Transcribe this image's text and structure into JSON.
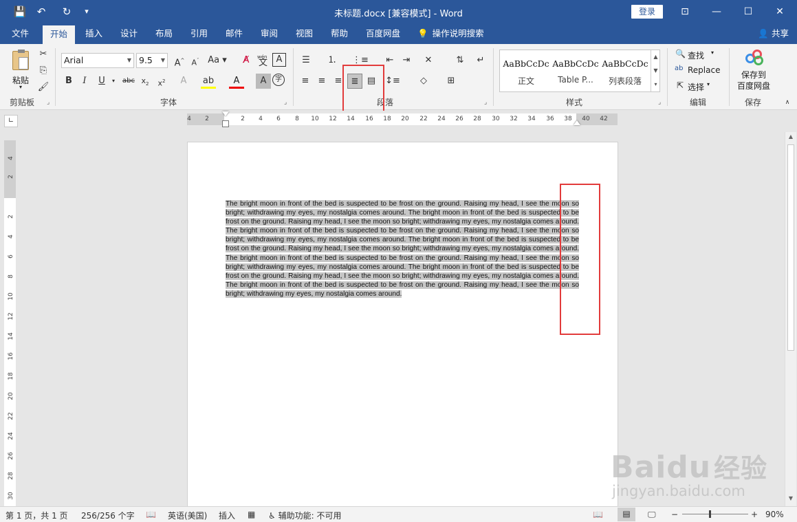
{
  "titlebar": {
    "title": "未标题.docx [兼容模式]  -  Word",
    "login": "登录",
    "quick_access": {
      "save": "💾",
      "undo": "↶",
      "redo": "↻",
      "customize": "▾"
    },
    "window_buttons": {
      "ribbon_options": "⊡",
      "minimize": "—",
      "maximize": "☐",
      "close": "✕"
    }
  },
  "tabs": [
    "文件",
    "开始",
    "插入",
    "设计",
    "布局",
    "引用",
    "邮件",
    "审阅",
    "视图",
    "帮助",
    "百度网盘",
    "操作说明搜索"
  ],
  "active_tab": "开始",
  "share": "共享",
  "ribbon": {
    "clipboard": {
      "paste_label": "粘贴",
      "group_label": "剪贴板"
    },
    "font": {
      "name": "Arial",
      "size": "9.5",
      "group_label": "字体",
      "pinyin": "wén"
    },
    "paragraph": {
      "group_label": "段落"
    },
    "styles": {
      "group_label": "样式",
      "items": [
        {
          "sample": "AaBbCcDc",
          "name": "正文"
        },
        {
          "sample": "AaBbCcDc",
          "name": "Table P..."
        },
        {
          "sample": "AaBbCcDc",
          "name": "列表段落"
        }
      ]
    },
    "editing": {
      "group_label": "编辑",
      "find": "查找",
      "replace": "Replace",
      "select": "选择"
    },
    "save_group": {
      "label_line1": "保存到",
      "label_line2": "百度网盘",
      "group_label": "保存"
    }
  },
  "ruler": {
    "h_left": [
      "4",
      "2"
    ],
    "h_right": [
      "2",
      "4",
      "6",
      "8",
      "10",
      "12",
      "14",
      "16",
      "18",
      "20",
      "22",
      "24",
      "26",
      "28",
      "30",
      "32",
      "34",
      "36",
      "38",
      "40",
      "42"
    ],
    "v_top": [
      "4",
      "2"
    ],
    "v_body": [
      "2",
      "4",
      "6",
      "8",
      "10",
      "12",
      "14",
      "16",
      "18",
      "20",
      "22",
      "24",
      "26",
      "28",
      "30"
    ]
  },
  "document": {
    "body": "The bright moon in front of the bed is suspected to be frost on the ground. Raising my head, I see the moon so bright; withdrawing my eyes, my nostalgia comes around.  The bright moon in front of the bed is suspected to be frost on the ground. Raising my head, I see the moon so bright; withdrawing my eyes, my nostalgia comes around.  The bright moon in front of the bed is suspected to be frost on the ground. Raising my head, I see the moon so bright; withdrawing my eyes, my nostalgia comes around.  The bright moon in front of the bed is suspected to be frost on the ground. Raising my head, I see the moon so bright; withdrawing my eyes, my nostalgia comes around.  The bright moon in front of the bed is suspected to be frost on the ground. Raising my head, I see the moon so bright; withdrawing my eyes, my nostalgia comes around.  The bright moon in front of the bed is suspected to be frost on the ground. Raising my head, I see the moon so bright; withdrawing my eyes, my nostalgia comes around.  The bright moon in front of the bed is suspected to be frost on the ground. Raising my head, I see the moon so bright; withdrawing my eyes, my nostalgia comes around."
  },
  "statusbar": {
    "page": "第 1 页，共 1 页",
    "words": "256/256 个字",
    "language": "英语(美国)",
    "mode": "插入",
    "accessibility": "辅助功能: 不可用",
    "zoom": "90%"
  },
  "watermark": {
    "brand": "Baidu",
    "cn": "经验",
    "url": "jingyan.baidu.com"
  },
  "colors": {
    "accent": "#2b579a",
    "highlight_box": "#e23b3b",
    "selection": "#c6c6c6"
  }
}
